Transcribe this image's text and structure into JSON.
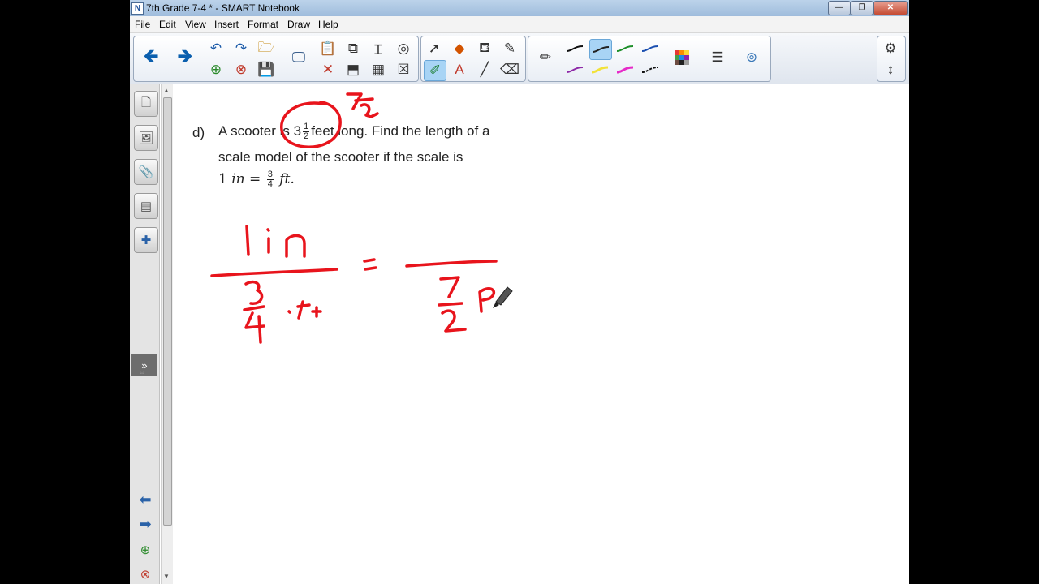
{
  "window": {
    "title": "7th Grade 7-4 * - SMART Notebook",
    "min": "—",
    "max": "❐",
    "close": "✕"
  },
  "menu": [
    "File",
    "Edit",
    "View",
    "Insert",
    "Format",
    "Draw",
    "Help"
  ],
  "icons": {
    "back": "back-arrow-icon",
    "forward": "forward-arrow-icon",
    "undo": "undo-icon",
    "redo": "redo-icon",
    "open": "open-folder-icon",
    "add_page": "add-page-icon",
    "delete_page": "delete-page-icon",
    "save": "save-icon",
    "gear": "gear-icon",
    "resize": "move-toolbar-icon"
  },
  "side_tabs": {
    "expand": "»"
  },
  "question": {
    "label": "d)",
    "line1_a": "A scooter is 3",
    "frac1_n": "1",
    "frac1_d": "2",
    "line1_b": "feet long. Find the length of a",
    "line2": "scale model of the scooter if the scale is",
    "eq_a": "1 ",
    "eq_in": "in",
    "eq_eq": " = ",
    "frac2_n": "3",
    "frac2_d": "4",
    "eq_ft": " ft."
  },
  "colors": {
    "ink": "#e8141c",
    "accent": "#0b5fae",
    "toolbar_active": "#a8d4f5"
  }
}
